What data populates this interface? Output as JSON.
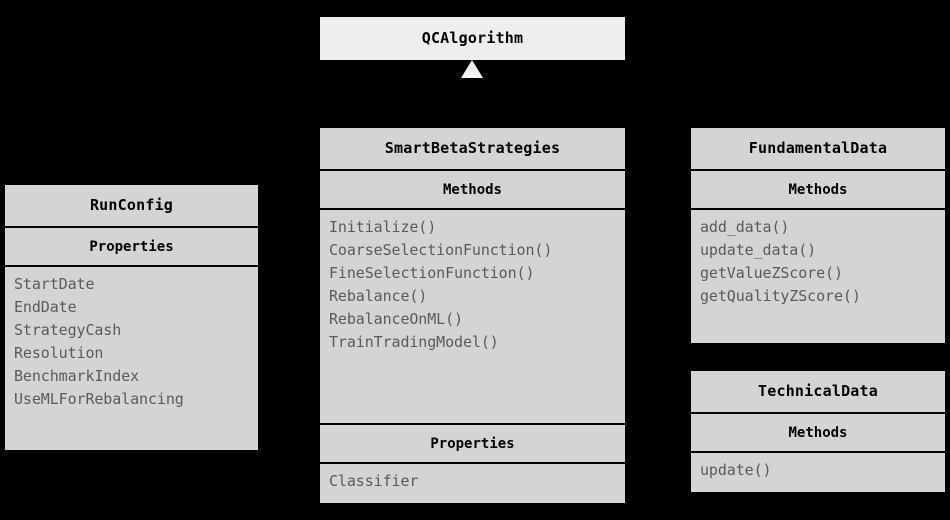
{
  "diagram": {
    "kind": "uml-class-diagram",
    "background_color": "#000000",
    "box_fill": "#d4d4d4",
    "parent_box_fill": "#eeeeee",
    "member_text_color": "#5a5a5a",
    "title_text_color": "#000000",
    "arrow_color": "#f2f2f2"
  },
  "classes": {
    "qcalgorithm": {
      "name": "QCAlgorithm",
      "sections": []
    },
    "smartbetastrategies": {
      "name": "SmartBetaStrategies",
      "methods_label": "Methods",
      "methods": [
        "Initialize()",
        "CoarseSelectionFunction()",
        "FineSelectionFunction()",
        "Rebalance()",
        "RebalanceOnML()",
        "TrainTradingModel()"
      ],
      "properties_label": "Properties",
      "properties": [
        "Classifier"
      ]
    },
    "runconfig": {
      "name": "RunConfig",
      "properties_label": "Properties",
      "properties": [
        "StartDate",
        "EndDate",
        "StrategyCash",
        "Resolution",
        "BenchmarkIndex",
        "UseMLForRebalancing"
      ]
    },
    "fundamentaldata": {
      "name": "FundamentalData",
      "methods_label": "Methods",
      "methods": [
        "add_data()",
        "update_data()",
        "getValueZScore()",
        "getQualityZScore()"
      ]
    },
    "technicaldata": {
      "name": "TechnicalData",
      "methods_label": "Methods",
      "methods": [
        "update()"
      ]
    }
  },
  "relationships": [
    {
      "type": "generalization",
      "from": "SmartBetaStrategies",
      "to": "QCAlgorithm",
      "marker": "hollow-triangle-arrowhead"
    }
  ]
}
